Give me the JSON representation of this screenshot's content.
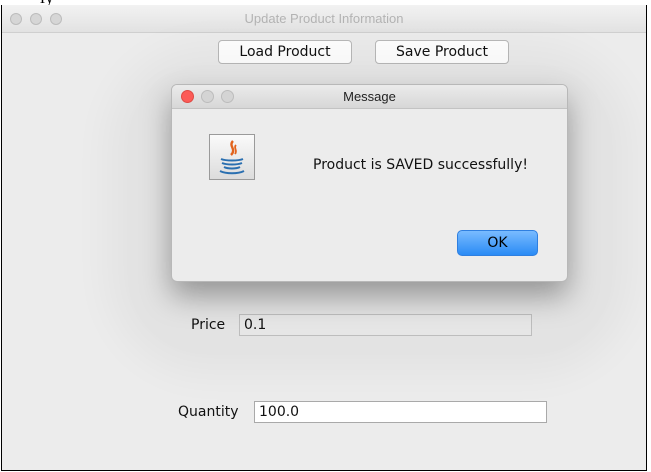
{
  "window": {
    "title": "Update Product Information",
    "buttons": {
      "load": "Load Product",
      "save": "Save Product"
    },
    "fields": {
      "price": {
        "label": "Price",
        "value": "0.1"
      },
      "quantity": {
        "label": "Quantity",
        "value": "100.0"
      }
    }
  },
  "dialog": {
    "title": "Message",
    "icon": "java-icon",
    "message": "Product is SAVED successfully!",
    "ok_label": "OK"
  },
  "colors": {
    "ok_button": "#2a8bf5",
    "close_dot": "#fc5b57"
  }
}
